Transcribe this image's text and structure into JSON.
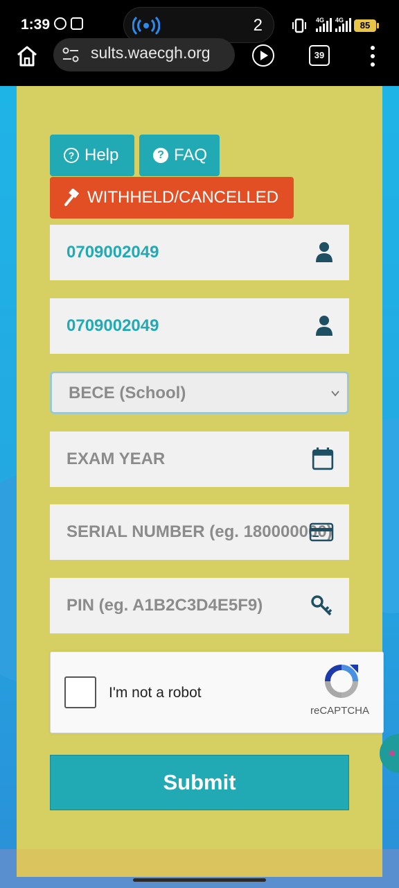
{
  "status_bar": {
    "time": "1:39",
    "notification_count": "2",
    "network_1": "4G",
    "network_2": "4G",
    "battery": "85"
  },
  "browser": {
    "url": "sults.waecgh.org",
    "tab_count": "39"
  },
  "form": {
    "help_label": "Help",
    "faq_label": "FAQ",
    "withheld_label": "WITHHELD/CANCELLED",
    "index_number_1": "0709002049",
    "index_number_2": "0709002049",
    "exam_type_selected": "BECE (School)",
    "exam_year_placeholder": "EXAM YEAR",
    "serial_placeholder": "SERIAL NUMBER (eg. 180000000)",
    "pin_placeholder": "PIN (eg. A1B2C3D4E5F9)",
    "submit_label": "Submit"
  },
  "recaptcha": {
    "label": "I'm not a robot",
    "brand": "reCAPTCHA"
  },
  "colors": {
    "card_background": "#d6d062",
    "teal": "#22aab4",
    "red": "#e34f25",
    "page_background": "#1fb4e6"
  },
  "icons": [
    "whatsapp-icon",
    "record-icon",
    "broadcast-icon",
    "vibrate-icon",
    "home-icon",
    "site-settings-icon",
    "play-icon",
    "tabs-icon",
    "more-menu-icon",
    "help-icon",
    "faq-icon",
    "gavel-icon",
    "user-icon",
    "calendar-icon",
    "card-icon",
    "key-icon",
    "chevron-down-icon",
    "recaptcha-logo-icon"
  ]
}
